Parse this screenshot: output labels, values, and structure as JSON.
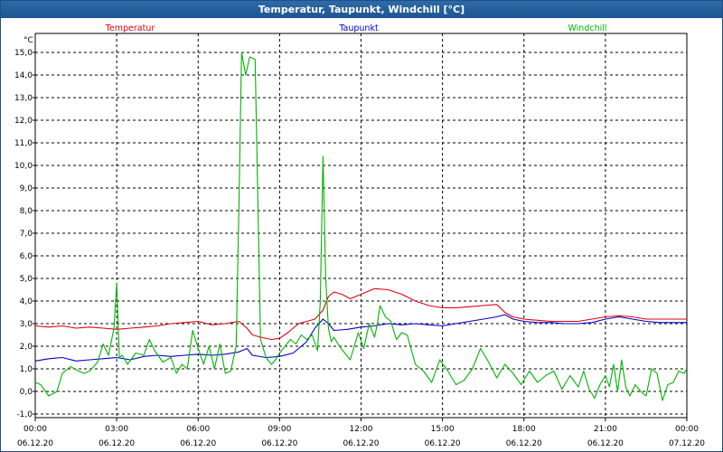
{
  "window": {
    "title": "Temperatur, Taupunkt, Windchill [°C]"
  },
  "chart_data": {
    "type": "line",
    "title": "Temperatur, Taupunkt, Windchill [°C]",
    "ylabel": "°C",
    "ylim": [
      -1.0,
      16.0
    ],
    "yticks": [
      "-1,0",
      "0,0",
      "1,0",
      "2,0",
      "3,0",
      "4,0",
      "5,0",
      "6,0",
      "7,0",
      "8,0",
      "9,0",
      "10,0",
      "11,0",
      "12,0",
      "13,0",
      "14,0",
      "15,0"
    ],
    "xlim": [
      0,
      24
    ],
    "xticks": [
      {
        "time": "00:00",
        "date": "06.12.20"
      },
      {
        "time": "03:00",
        "date": "06.12.20"
      },
      {
        "time": "06:00",
        "date": "06.12.20"
      },
      {
        "time": "09:00",
        "date": "06.12.20"
      },
      {
        "time": "12:00",
        "date": "06.12.20"
      },
      {
        "time": "15:00",
        "date": "06.12.20"
      },
      {
        "time": "18:00",
        "date": "06.12.20"
      },
      {
        "time": "21:00",
        "date": "06.12.20"
      },
      {
        "time": "00:00",
        "date": "07.12.20"
      }
    ],
    "grid": true,
    "legend_position": "top",
    "series": [
      {
        "name": "Temperatur",
        "color": "#e0000f",
        "x": [
          0,
          0.5,
          1,
          1.5,
          2,
          2.5,
          3,
          3.5,
          4,
          4.5,
          5,
          5.5,
          6,
          6.5,
          7,
          7.5,
          7.8,
          8,
          8.3,
          8.7,
          9,
          9.3,
          9.7,
          10,
          10.3,
          10.6,
          10.8,
          11,
          11.3,
          11.6,
          12,
          12.5,
          13,
          13.5,
          14,
          14.5,
          15,
          15.5,
          16,
          16.5,
          17,
          17.3,
          17.6,
          18,
          18.5,
          19,
          19.5,
          20,
          20.5,
          21,
          21.5,
          22,
          22.5,
          23,
          23.5,
          24
        ],
        "values": [
          2.9,
          2.85,
          2.9,
          2.8,
          2.85,
          2.8,
          2.75,
          2.8,
          2.85,
          2.9,
          3.0,
          3.05,
          3.1,
          2.95,
          3.0,
          3.1,
          2.8,
          2.5,
          2.4,
          2.3,
          2.35,
          2.6,
          3.0,
          3.1,
          3.2,
          3.6,
          4.2,
          4.4,
          4.3,
          4.1,
          4.3,
          4.55,
          4.5,
          4.3,
          4.0,
          3.8,
          3.7,
          3.7,
          3.75,
          3.8,
          3.85,
          3.5,
          3.3,
          3.2,
          3.15,
          3.1,
          3.1,
          3.1,
          3.2,
          3.3,
          3.35,
          3.3,
          3.2,
          3.2,
          3.2,
          3.2
        ]
      },
      {
        "name": "Taupunkt",
        "color": "#0000c8",
        "x": [
          0,
          0.5,
          1,
          1.5,
          2,
          2.5,
          3,
          3.5,
          4,
          4.5,
          5,
          5.5,
          6,
          6.5,
          7,
          7.5,
          7.8,
          8,
          8.5,
          9,
          9.5,
          10,
          10.3,
          10.6,
          10.8,
          11,
          11.5,
          12,
          12.5,
          13,
          13.5,
          14,
          14.5,
          15,
          15.5,
          16,
          16.5,
          17,
          17.3,
          17.6,
          18,
          18.5,
          19,
          19.5,
          20,
          20.5,
          21,
          21.5,
          22,
          22.5,
          23,
          23.5,
          24
        ],
        "values": [
          1.35,
          1.45,
          1.5,
          1.35,
          1.4,
          1.45,
          1.5,
          1.4,
          1.55,
          1.6,
          1.55,
          1.6,
          1.65,
          1.6,
          1.65,
          1.75,
          1.9,
          1.6,
          1.5,
          1.55,
          1.7,
          2.2,
          2.8,
          3.2,
          3.0,
          2.7,
          2.75,
          2.85,
          2.9,
          3.0,
          2.95,
          3.0,
          2.95,
          2.9,
          3.0,
          3.1,
          3.2,
          3.3,
          3.4,
          3.2,
          3.1,
          3.05,
          3.05,
          3.0,
          3.0,
          3.05,
          3.2,
          3.3,
          3.2,
          3.1,
          3.05,
          3.05,
          3.05
        ]
      },
      {
        "name": "Windchill",
        "color": "#00b400",
        "x": [
          0,
          0.2,
          0.5,
          0.8,
          1,
          1.3,
          1.6,
          1.8,
          2,
          2.3,
          2.5,
          2.7,
          2.9,
          3.0,
          3.1,
          3.2,
          3.4,
          3.7,
          4,
          4.2,
          4.4,
          4.7,
          5,
          5.2,
          5.4,
          5.6,
          5.8,
          6,
          6.2,
          6.4,
          6.6,
          6.8,
          7,
          7.2,
          7.4,
          7.5,
          7.6,
          7.75,
          7.9,
          8.1,
          8.3,
          8.5,
          8.7,
          8.85,
          9,
          9.2,
          9.4,
          9.6,
          9.8,
          10,
          10.2,
          10.4,
          10.5,
          10.6,
          10.7,
          10.8,
          10.9,
          11.0,
          11.2,
          11.4,
          11.6,
          11.9,
          12.1,
          12.3,
          12.5,
          12.6,
          12.7,
          12.9,
          13.1,
          13.3,
          13.5,
          13.7,
          14,
          14.3,
          14.6,
          14.9,
          15.2,
          15.5,
          15.8,
          16.1,
          16.4,
          16.7,
          17,
          17.3,
          17.6,
          17.9,
          18.2,
          18.5,
          18.8,
          19.1,
          19.4,
          19.7,
          20,
          20.2,
          20.4,
          20.6,
          20.8,
          21,
          21.15,
          21.3,
          21.45,
          21.6,
          21.75,
          21.9,
          22.1,
          22.3,
          22.5,
          22.7,
          22.9,
          23.1,
          23.3,
          23.5,
          23.7,
          23.9,
          24
        ],
        "values": [
          0.4,
          0.3,
          -0.2,
          0.0,
          0.8,
          1.1,
          0.9,
          0.8,
          0.9,
          1.3,
          2.1,
          1.6,
          2.8,
          4.8,
          1.5,
          1.6,
          1.2,
          1.7,
          1.6,
          2.3,
          1.8,
          1.3,
          1.5,
          0.8,
          1.2,
          1.0,
          2.7,
          1.9,
          1.2,
          2.0,
          1.0,
          2.1,
          0.8,
          0.9,
          2.0,
          8.0,
          15.0,
          14.0,
          14.8,
          14.7,
          2.3,
          1.5,
          1.2,
          1.4,
          1.7,
          2.0,
          2.3,
          2.1,
          2.5,
          2.3,
          2.5,
          1.8,
          4.0,
          10.4,
          5.0,
          2.8,
          2.2,
          2.4,
          2.0,
          1.7,
          1.4,
          2.6,
          1.9,
          3.0,
          2.4,
          3.0,
          3.8,
          3.3,
          3.1,
          2.3,
          2.6,
          2.5,
          1.2,
          0.9,
          0.4,
          1.4,
          0.9,
          0.3,
          0.5,
          1.0,
          1.9,
          1.3,
          0.6,
          1.2,
          0.8,
          0.3,
          0.9,
          0.4,
          0.7,
          0.9,
          0.1,
          0.7,
          0.2,
          0.9,
          0.1,
          -0.3,
          0.3,
          0.7,
          0.2,
          1.2,
          0.0,
          1.4,
          0.2,
          -0.2,
          0.3,
          0.0,
          -0.2,
          1.0,
          0.8,
          -0.4,
          0.3,
          0.4,
          0.9,
          0.8,
          1.0
        ]
      }
    ]
  }
}
